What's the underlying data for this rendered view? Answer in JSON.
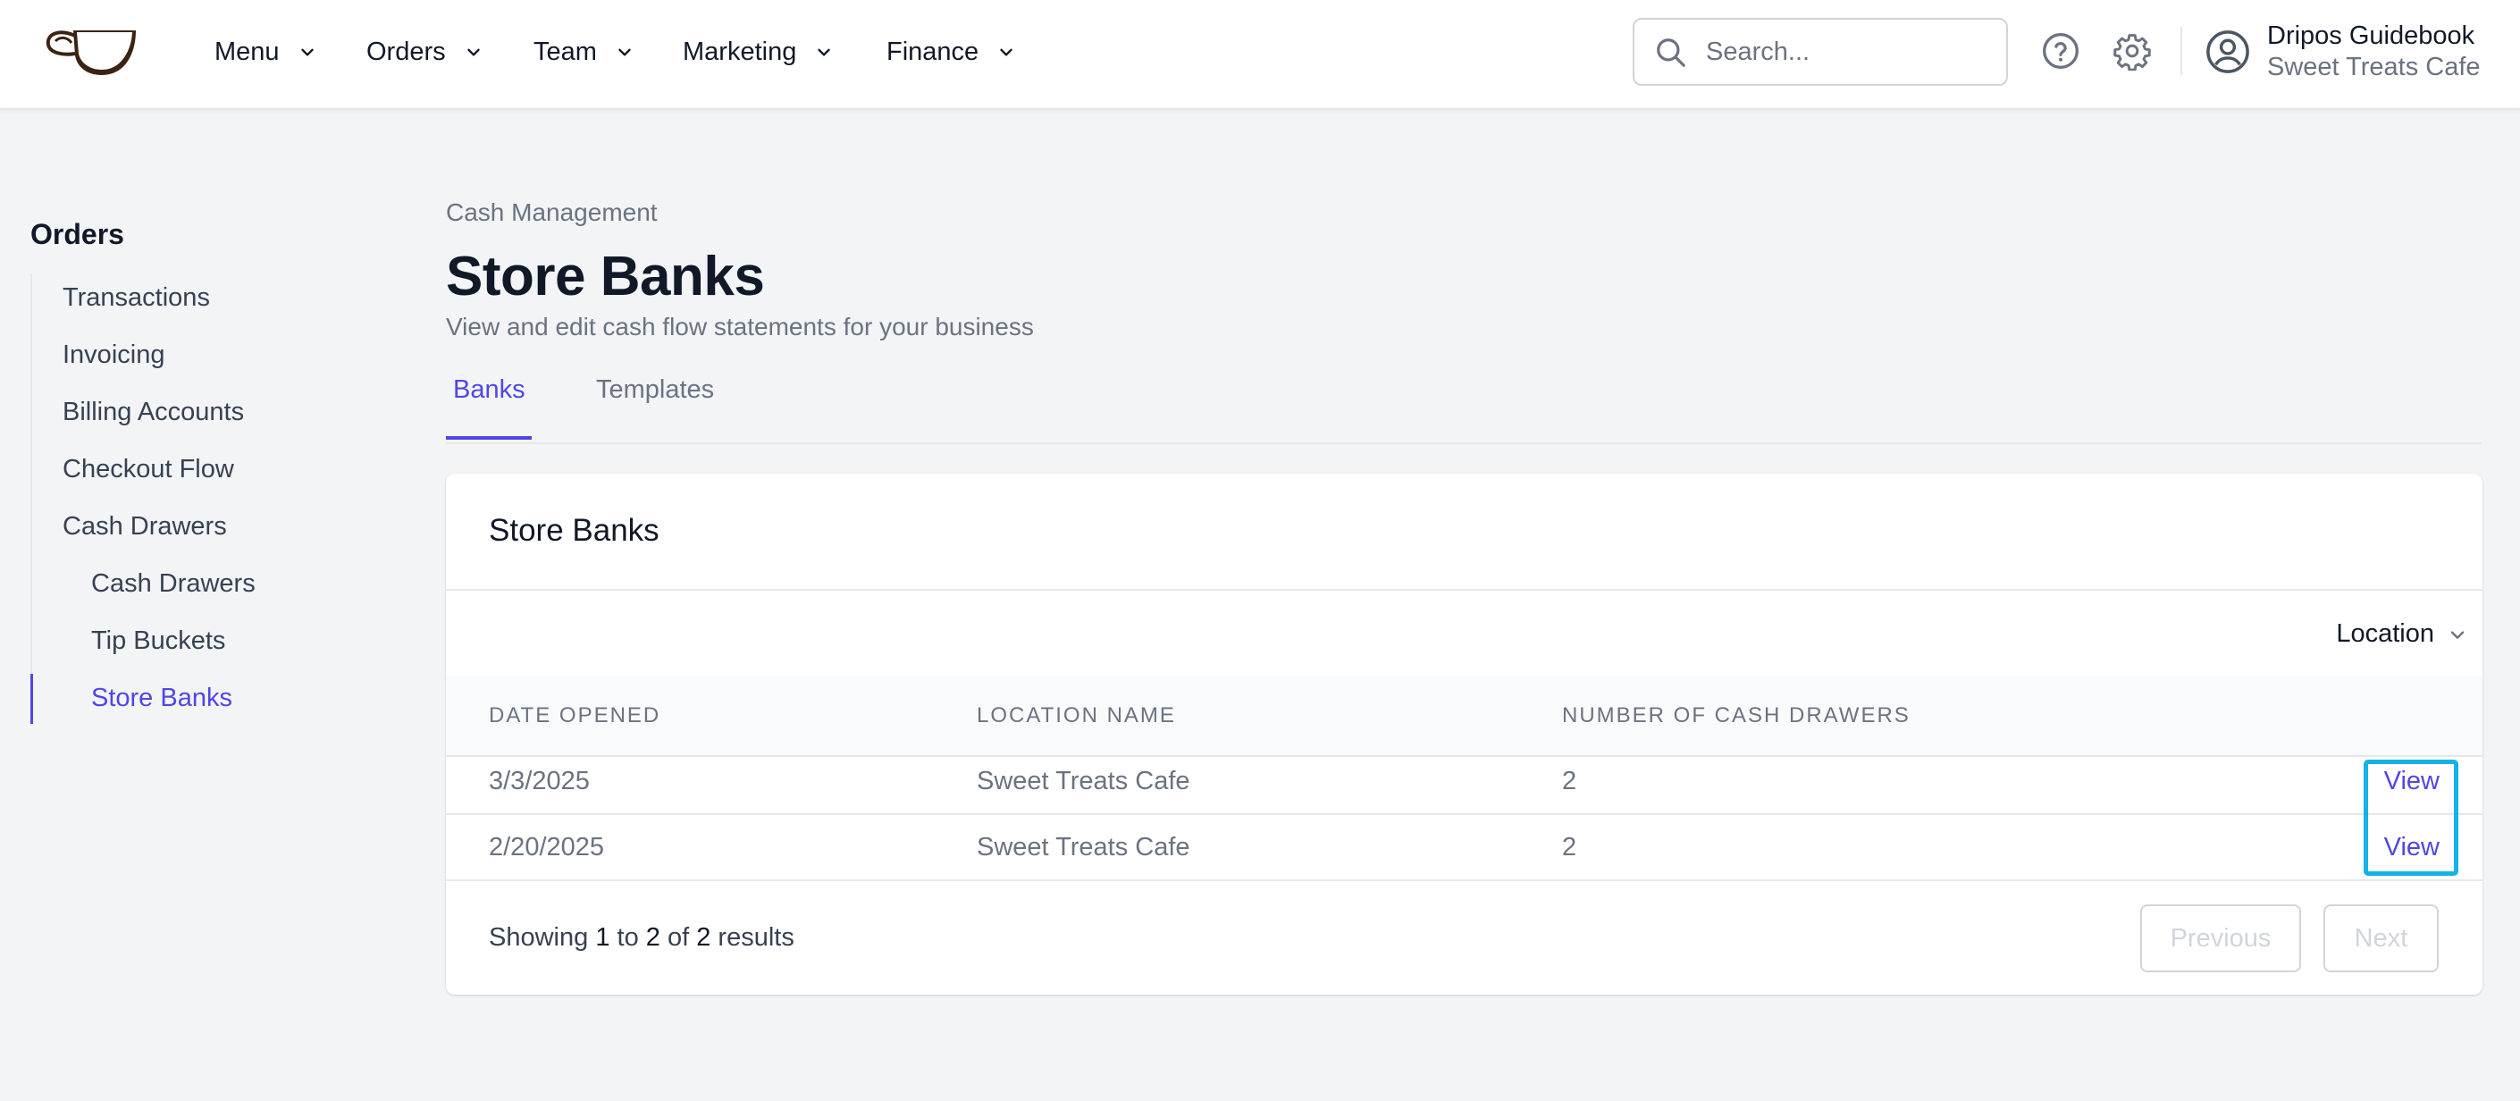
{
  "header": {
    "logo_icon": "coffee-cup-logo",
    "nav": [
      {
        "label": "Menu"
      },
      {
        "label": "Orders"
      },
      {
        "label": "Team"
      },
      {
        "label": "Marketing"
      },
      {
        "label": "Finance"
      }
    ],
    "search": {
      "placeholder": "Search...",
      "value": ""
    },
    "user": {
      "name": "Dripos Guidebook",
      "business": "Sweet Treats Cafe"
    }
  },
  "sidebar": {
    "title": "Orders",
    "items": [
      {
        "label": "Transactions"
      },
      {
        "label": "Invoicing"
      },
      {
        "label": "Billing Accounts"
      },
      {
        "label": "Checkout Flow"
      },
      {
        "label": "Cash Drawers"
      },
      {
        "label": "Cash Drawers"
      },
      {
        "label": "Tip Buckets"
      },
      {
        "label": "Store Banks"
      }
    ]
  },
  "page": {
    "breadcrumb": "Cash Management",
    "title": "Store Banks",
    "subtitle": "View and edit cash flow statements for your business",
    "tabs": [
      {
        "label": "Banks"
      },
      {
        "label": "Templates"
      }
    ]
  },
  "card": {
    "title": "Store Banks",
    "filter_label": "Location",
    "columns": [
      "Date Opened",
      "Location Name",
      "Number of Cash Drawers"
    ],
    "rows": [
      {
        "date": "3/3/2025",
        "location": "Sweet Treats Cafe",
        "drawers": "2",
        "action": "View"
      },
      {
        "date": "2/20/2025",
        "location": "Sweet Treats Cafe",
        "drawers": "2",
        "action": "View"
      }
    ],
    "pagination": {
      "prefix": "Showing",
      "from": "1",
      "mid1": "to",
      "to": "2",
      "mid2": "of",
      "total": "2",
      "suffix": "results",
      "prev_label": "Previous",
      "next_label": "Next"
    }
  },
  "colors": {
    "accent": "#4f46e5",
    "highlight": "#14b2e6",
    "background": "#f3f4f6"
  }
}
